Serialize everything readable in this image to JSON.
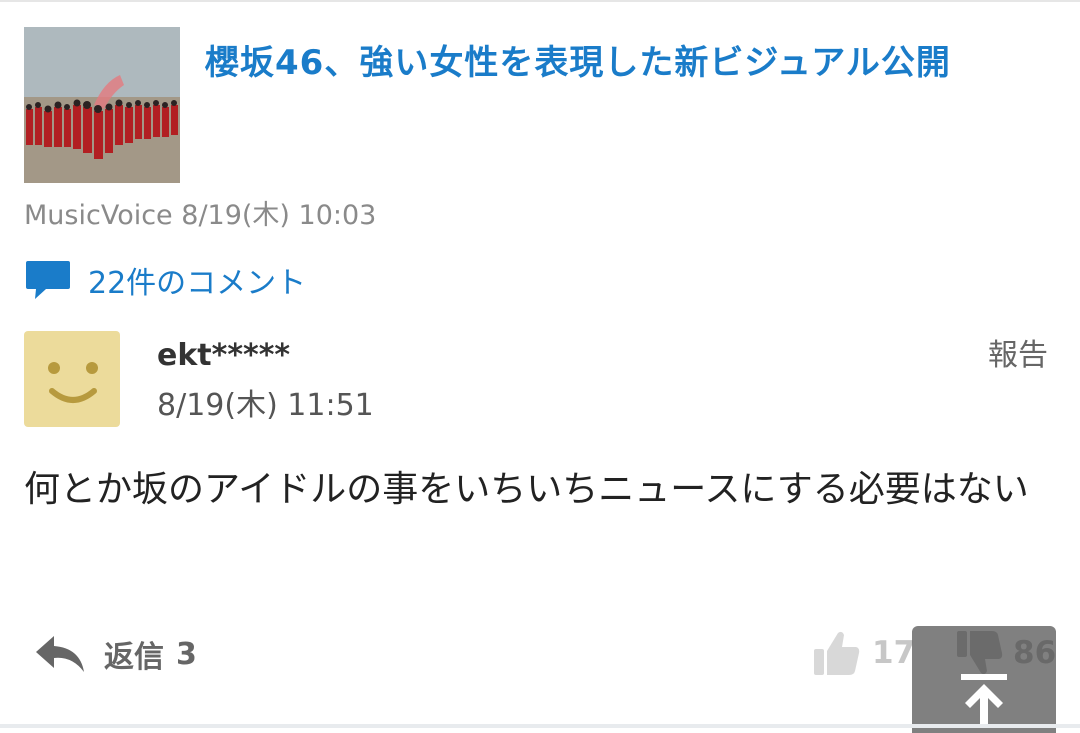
{
  "article": {
    "title": "櫻坂46、強い女性を表現した新ビジュアル公開",
    "source": "MusicVoice",
    "datetime": "8/19(木) 10:03",
    "comments_link": "22件のコメント"
  },
  "comment": {
    "username": "ekt*****",
    "datetime": "8/19(木) 11:51",
    "report_label": "報告",
    "body": "何とか坂のアイドルの事をいちいちニュースにする必要はない",
    "reply_label": "返信",
    "reply_count": "3",
    "like_count": "17",
    "dislike_count": "86"
  },
  "icons": {
    "comments": "speech-bubble-icon",
    "reply": "reply-arrow-icon",
    "like": "thumbs-up-icon",
    "dislike": "thumbs-down-icon",
    "scroll_top": "arrow-up-to-top-icon"
  },
  "colors": {
    "accent": "#1a7cc9",
    "avatar_bg": "#ecdb9b",
    "avatar_face": "#b79a3e"
  }
}
